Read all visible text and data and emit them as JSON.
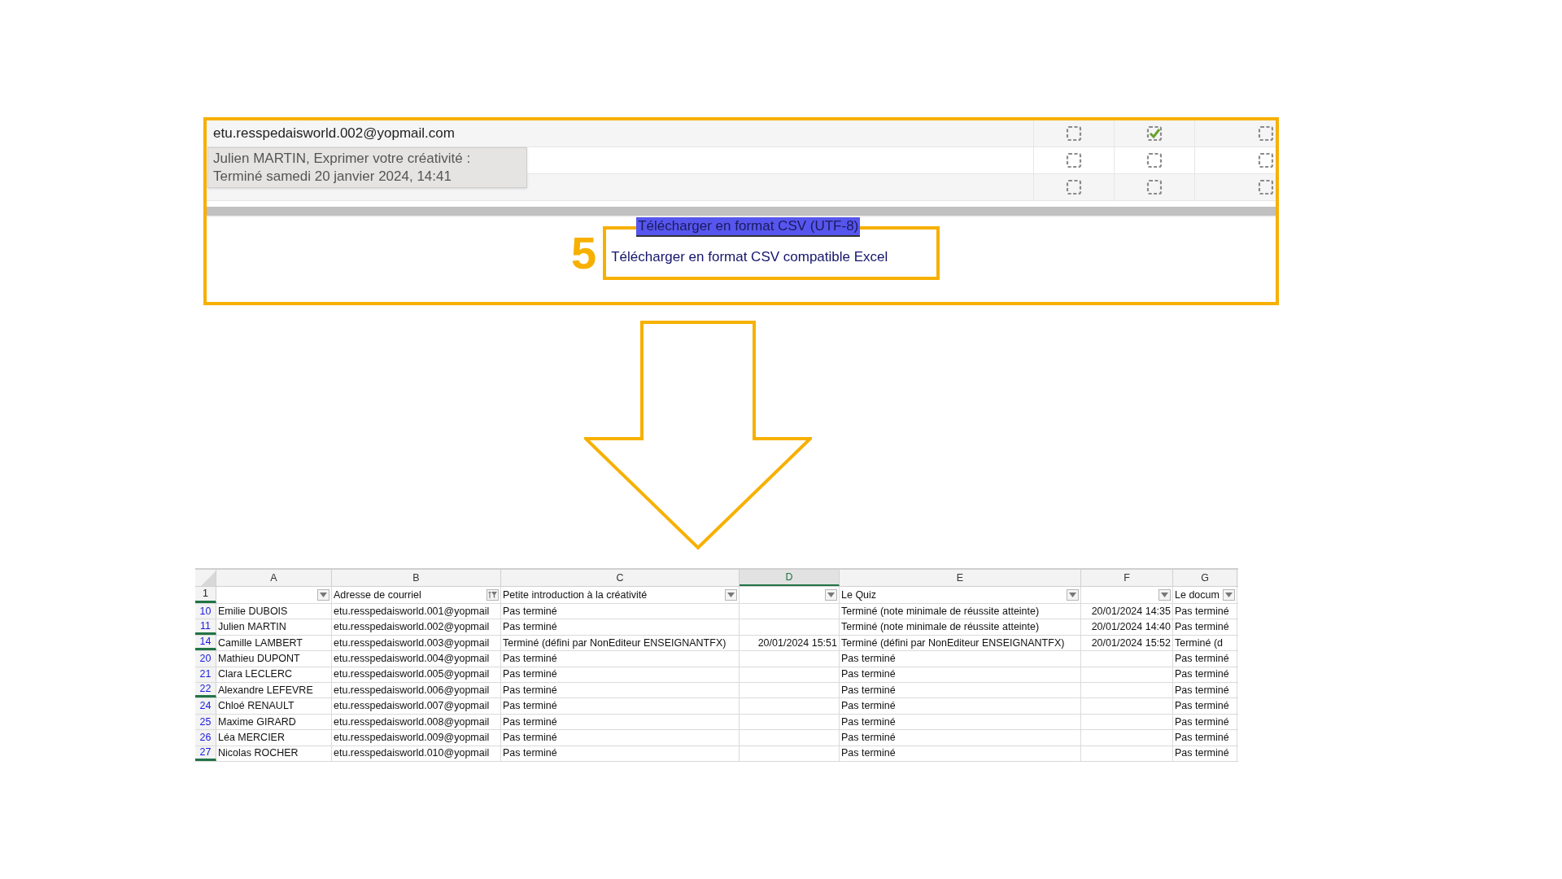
{
  "completion_table": {
    "rows": [
      {
        "email": "etu.resspedaisworld.002@yopmail.com",
        "checkboxes": [
          {
            "checked": false
          },
          {
            "checked": true
          },
          {
            "checked": false
          }
        ]
      },
      {
        "checkboxes": [
          {
            "checked": false
          },
          {
            "checked": false
          },
          {
            "checked": false
          }
        ]
      },
      {
        "checkboxes": [
          {
            "checked": false
          },
          {
            "checked": false
          },
          {
            "checked": false
          }
        ]
      }
    ]
  },
  "tooltip": {
    "lines": [
      "Julien MARTIN, Exprimer votre créativité :",
      "Terminé samedi 20 janvier 2024, 14:41"
    ]
  },
  "step_number": "5",
  "download_links": [
    {
      "label": "Télécharger en format CSV (UTF-8)",
      "selected": true
    },
    {
      "label": "Télécharger en format CSV compatible Excel",
      "selected": false
    }
  ],
  "spreadsheet": {
    "columns": [
      {
        "letter": "A",
        "selected": false
      },
      {
        "letter": "B",
        "selected": false
      },
      {
        "letter": "C",
        "selected": false
      },
      {
        "letter": "D",
        "selected": true
      },
      {
        "letter": "E",
        "selected": false
      },
      {
        "letter": "F",
        "selected": false
      },
      {
        "letter": "G",
        "selected": false
      }
    ],
    "header_row": {
      "number": "1",
      "hidden_after": true,
      "cells": [
        {
          "filtered": false
        },
        {
          "text": "Adresse de courriel",
          "filtered": true
        },
        {
          "text": "Petite introduction à la créativité",
          "filtered": false
        },
        {
          "filtered": false
        },
        {
          "text": "Le Quiz",
          "filtered": false
        },
        {
          "filtered": false
        },
        {
          "text": "Le docum",
          "filtered": false
        }
      ]
    },
    "rows": [
      {
        "number": "10",
        "hidden_after": false,
        "cells": [
          "Emilie DUBOIS",
          "etu.resspedaisworld.001@yopmail",
          "Pas terminé",
          null,
          "Terminé (note minimale de réussite atteinte)",
          "20/01/2024 14:35",
          "Pas terminé"
        ]
      },
      {
        "number": "11",
        "hidden_after": true,
        "cells": [
          "Julien MARTIN",
          "etu.resspedaisworld.002@yopmail",
          "Pas terminé",
          null,
          "Terminé (note minimale de réussite atteinte)",
          "20/01/2024 14:40",
          "Pas terminé"
        ]
      },
      {
        "number": "14",
        "hidden_after": true,
        "cells": [
          "Camille LAMBERT",
          "etu.resspedaisworld.003@yopmail",
          "Terminé (défini par NonEditeur ENSEIGNANTFX)",
          "20/01/2024 15:51",
          "Terminé (défini par NonEditeur ENSEIGNANTFX)",
          "20/01/2024 15:52",
          "Terminé (d"
        ]
      },
      {
        "number": "20",
        "hidden_after": false,
        "cells": [
          "Mathieu DUPONT",
          "etu.resspedaisworld.004@yopmail",
          "Pas terminé",
          null,
          "Pas terminé",
          null,
          "Pas terminé"
        ]
      },
      {
        "number": "21",
        "hidden_after": false,
        "cells": [
          "Clara LECLERC",
          "etu.resspedaisworld.005@yopmail",
          "Pas terminé",
          null,
          "Pas terminé",
          null,
          "Pas terminé"
        ]
      },
      {
        "number": "22",
        "hidden_after": true,
        "cells": [
          "Alexandre LEFEVRE",
          "etu.resspedaisworld.006@yopmail",
          "Pas terminé",
          null,
          "Pas terminé",
          null,
          "Pas terminé"
        ]
      },
      {
        "number": "24",
        "hidden_after": false,
        "cells": [
          "Chloé RENAULT",
          "etu.resspedaisworld.007@yopmail",
          "Pas terminé",
          null,
          "Pas terminé",
          null,
          "Pas terminé"
        ]
      },
      {
        "number": "25",
        "hidden_after": false,
        "cells": [
          "Maxime GIRARD",
          "etu.resspedaisworld.008@yopmail",
          "Pas terminé",
          null,
          "Pas terminé",
          null,
          "Pas terminé"
        ]
      },
      {
        "number": "26",
        "hidden_after": false,
        "cells": [
          "Léa MERCIER",
          "etu.resspedaisworld.009@yopmail",
          "Pas terminé",
          null,
          "Pas terminé",
          null,
          "Pas terminé"
        ]
      },
      {
        "number": "27",
        "hidden_after": true,
        "cells": [
          "Nicolas ROCHER",
          "etu.resspedaisworld.010@yopmail",
          "Pas terminé",
          null,
          "Pas terminé",
          null,
          "Pas terminé"
        ]
      }
    ]
  }
}
